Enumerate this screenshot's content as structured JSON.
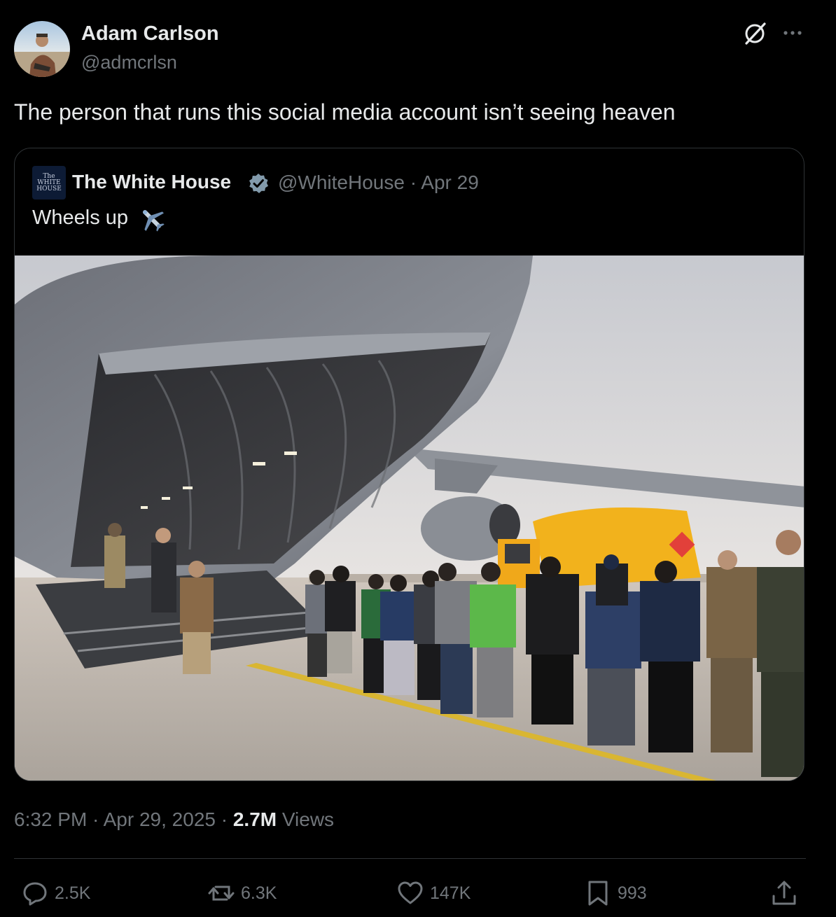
{
  "author": {
    "name": "Adam Carlson",
    "handle": "@admcrlsn"
  },
  "tweet": {
    "text": "The person that runs this social media account isn’t seeing heaven"
  },
  "quote": {
    "avatar_text": [
      "The",
      "WHITE",
      "HOUSE"
    ],
    "name": "The White House",
    "handle_date": "@WhiteHouse · Apr 29",
    "text": "Wheels up",
    "text_emoji_icon": "airplane-icon"
  },
  "meta": {
    "time_date": "6:32 PM · Apr 29, 2025 · ",
    "views_count": "2.7M",
    "views_label": " Views"
  },
  "actions": {
    "replies": "2.5K",
    "reposts": "6.3K",
    "likes": "147K",
    "bookmarks": "993"
  },
  "colors": {
    "background": "#000000",
    "text_primary": "#e7e9ea",
    "text_secondary": "#71767b",
    "border": "#2f3336",
    "verified": "#829aab"
  }
}
